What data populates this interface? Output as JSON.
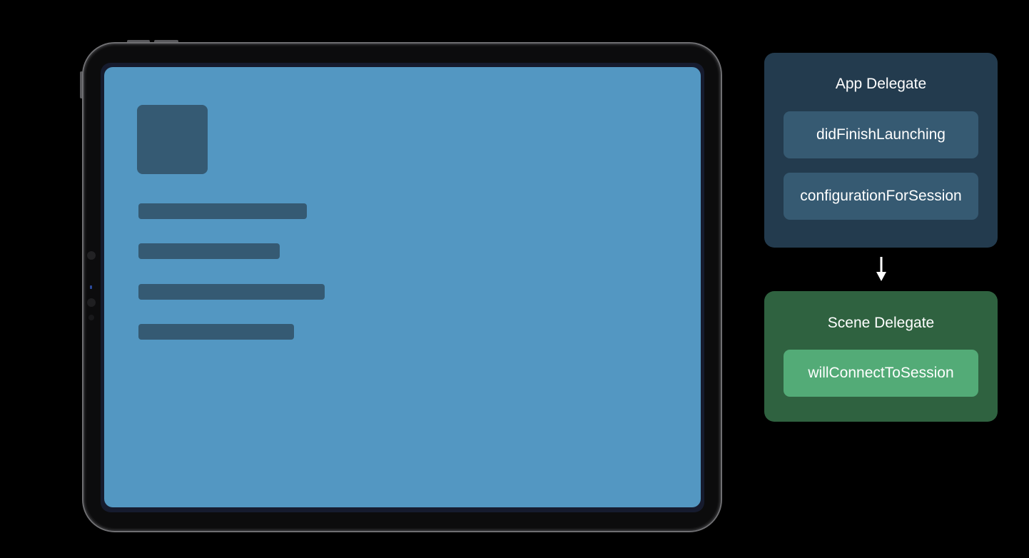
{
  "app_delegate": {
    "title": "App Delegate",
    "methods": [
      "didFinishLaunching",
      "configurationForSession"
    ],
    "color": "#233b4e",
    "method_color": "#365a72"
  },
  "scene_delegate": {
    "title": "Scene Delegate",
    "methods": [
      "willConnectToSession"
    ],
    "color": "#2f6240",
    "method_color": "#53ab77"
  },
  "flow_arrow": {
    "direction": "down",
    "from": "app_delegate",
    "to": "scene_delegate",
    "color": "#ffffff"
  },
  "device": {
    "type": "iPad",
    "screen_color": "#5397c2",
    "placeholder_color": "#355a73",
    "placeholder_lines": 4
  }
}
